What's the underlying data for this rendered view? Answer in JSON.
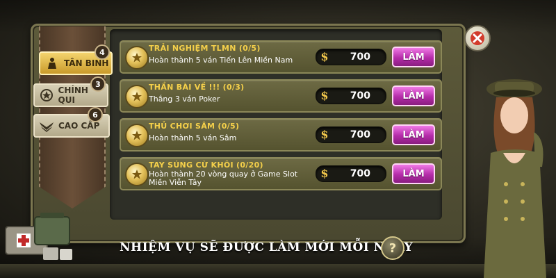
{
  "side_tabs": [
    {
      "label": "TÂN BINH",
      "badge": "4",
      "state": "active",
      "icon": "soldier-icon"
    },
    {
      "label": "CHÍNH QUI",
      "badge": "3",
      "state": "inactive",
      "icon": "star-wreath-icon"
    },
    {
      "label": "CAO CẤP",
      "badge": "6",
      "state": "inactive",
      "icon": "wings-icon"
    }
  ],
  "quests": [
    {
      "title": "TRẢI NGHIỆM TLMN (0/5)",
      "desc": "Hoàn thành 5 ván Tiến Lên Miền Nam",
      "desc2": "",
      "reward": "700",
      "button": "LÀM"
    },
    {
      "title": "THẦN BÀI VỀ !!! (0/3)",
      "desc": "Thắng 3 ván Poker",
      "desc2": "",
      "reward": "700",
      "button": "LÀM"
    },
    {
      "title": "THỦ CHƠI SÂM (0/5)",
      "desc": "Hoàn thành 5 ván Sâm",
      "desc2": "",
      "reward": "700",
      "button": "LÀM"
    },
    {
      "title": "TAY SÚNG CỪ KHÔI (0/20)",
      "desc": "Hoàn thành 20 vòng quay ở Game Slot",
      "desc2": "Miền Viễn Tây",
      "reward": "700",
      "button": "LÀM"
    }
  ],
  "reward_currency_symbol": "$",
  "footer": {
    "text": "NHIỆM VỤ SẼ ĐƯỢC LÀM MỚI MỖI NGÀY",
    "help_symbol": "?"
  },
  "colors": {
    "button": "#b52ca9",
    "title": "#f5d04a",
    "close": "#d23b2b"
  }
}
